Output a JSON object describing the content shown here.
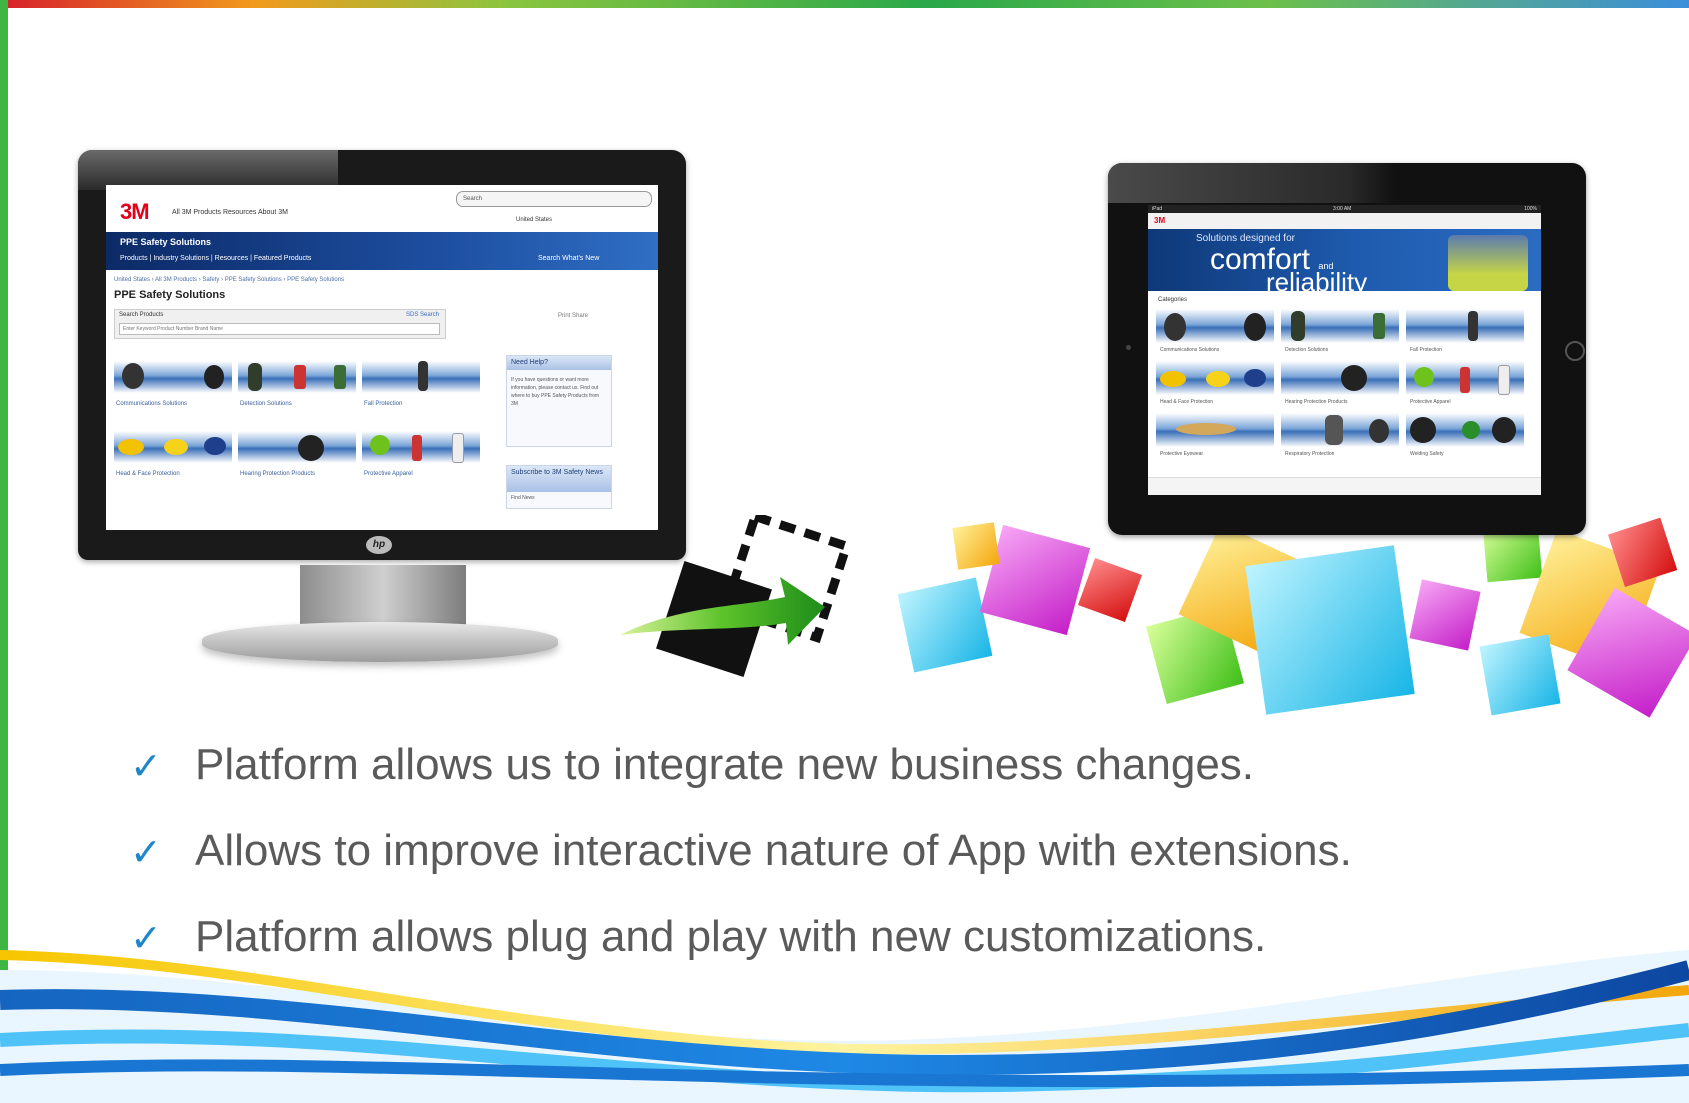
{
  "slide": {
    "bullets": [
      "Platform allows us to integrate new business changes.",
      "Allows to improve interactive nature of App with extensions.",
      "Platform allows plug and play with new customizations."
    ],
    "check_icon": "✓"
  },
  "desktop_site": {
    "logo": "3M",
    "nav": "All 3M Products   Resources   About 3M",
    "search_placeholder": "Search",
    "location": "United States",
    "banner_title": "PPE Safety Solutions",
    "tabs": "Products  |  Industry Solutions  |  Resources  |  Featured Products",
    "tabs_right": "Search    What's New",
    "breadcrumb": "United States › All 3M Products › Safety › PPE Safety Solutions › PPE Safety Solutions",
    "page_title": "PPE Safety Solutions",
    "search_label": "Search Products",
    "search_link": "SDS Search",
    "search_input_placeholder": "Enter Keyword Product Number Brand Name",
    "print_share": "Print   Share",
    "categories": [
      "Communications Solutions",
      "Detection Solutions",
      "Fall Protection",
      "Head & Face Protection",
      "Hearing Protection Products",
      "Protective Apparel"
    ],
    "sidebar_help_title": "Need Help?",
    "sidebar_help_text": "If you have questions or want more information, please contact us. Find out where to buy PPE Safety Products from 3M",
    "sidebar_news_title": "Subscribe to 3M Safety News",
    "sidebar_news_text": "Find News",
    "brand_badge": "hp"
  },
  "tablet_app": {
    "status_left": "iPad",
    "status_center": "3:00 AM",
    "status_right": "100%",
    "logo": "3M",
    "banner_line1": "Solutions designed for",
    "banner_line2": "comfort",
    "banner_and": "and",
    "banner_line3": "reliability",
    "categories_label": "Categories",
    "categories": [
      "Communications Solutions",
      "Detection Solutions",
      "Fall Protection",
      "Head & Face Protection",
      "Hearing Protection Products",
      "Protective Apparel",
      "Protective Eyewear",
      "Respiratory Protection",
      "Welding Safety"
    ]
  },
  "colors": {
    "accent_blue": "#1f86c8",
    "brand_red": "#e2001a",
    "text_gray": "#5a5a5a",
    "left_bar_green": "#3fb641"
  },
  "icons": [
    "migrate-arrow-icon",
    "check-icon",
    "cubes-decoration"
  ]
}
